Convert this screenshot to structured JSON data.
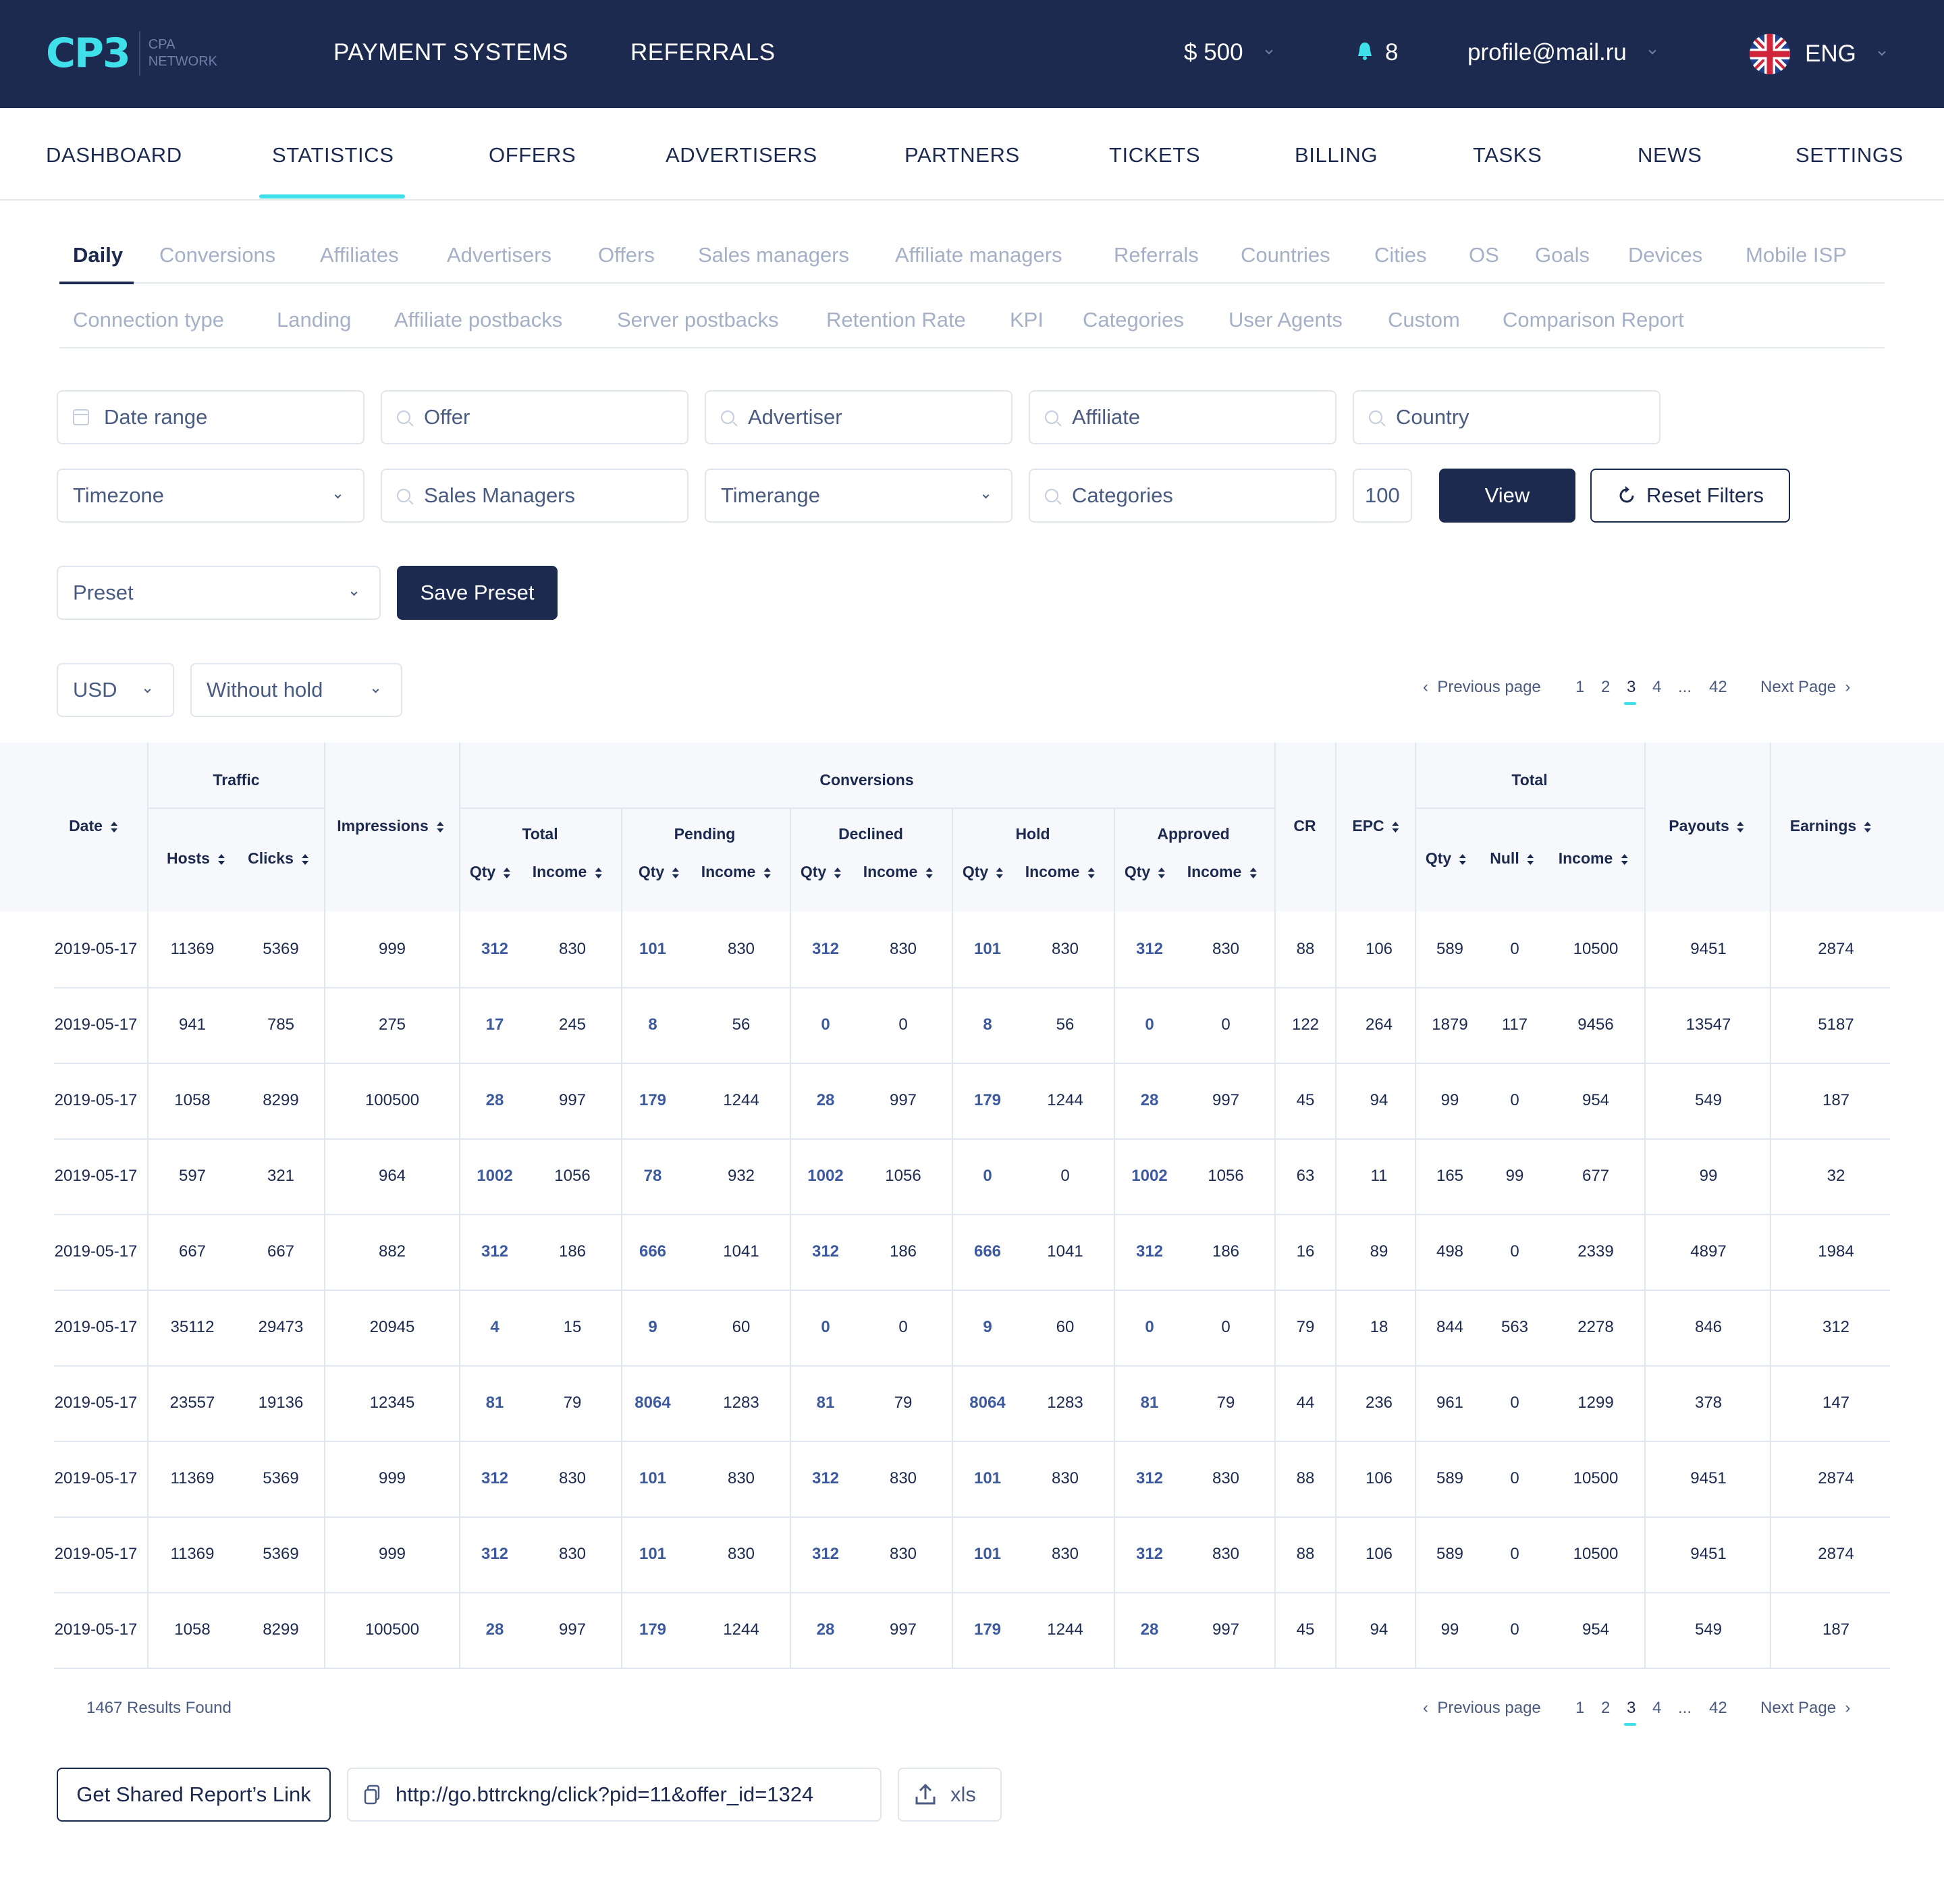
{
  "header": {
    "logo_main": "CP3",
    "logo_sub_1": "CPA",
    "logo_sub_2": "NETWORK",
    "nav": [
      "PAYMENT SYSTEMS",
      "REFERRALS"
    ],
    "balance": "$ 500",
    "notifications": "8",
    "profile": "profile@mail.ru",
    "language": "ENG"
  },
  "main_nav": [
    "DASHBOARD",
    "STATISTICS",
    "OFFERS",
    "ADVERTISERS",
    "PARTNERS",
    "TICKETS",
    "BILLING",
    "TASKS",
    "NEWS",
    "SETTINGS"
  ],
  "main_nav_active": "STATISTICS",
  "sub_tabs_row1": [
    "Daily",
    "Conversions",
    "Affiliates",
    "Advertisers",
    "Offers",
    "Sales managers",
    "Affiliate managers",
    "Referrals",
    "Countries",
    "Cities",
    "OS",
    "Goals",
    "Devices",
    "Mobile ISP"
  ],
  "sub_tabs_row2": [
    "Connection type",
    "Landing",
    "Affiliate postbacks",
    "Server postbacks",
    "Retention Rate",
    "KPI",
    "Categories",
    "User Agents",
    "Custom",
    "Comparison Report"
  ],
  "sub_tab_active": "Daily",
  "filters": {
    "date_range": "Date range",
    "offer": "Offer",
    "advertiser": "Advertiser",
    "affiliate": "Affiliate",
    "country": "Country",
    "timezone": "Timezone",
    "sales_managers": "Sales Managers",
    "timerange": "Timerange",
    "categories": "Categories",
    "limit": "100",
    "view_button": "View",
    "reset_button": "Reset Filters",
    "preset": "Preset",
    "save_preset": "Save Preset",
    "currency": "USD",
    "hold": "Without hold"
  },
  "pagination": {
    "prev": "Previous page",
    "pages": [
      "1",
      "2",
      "3",
      "4",
      "...",
      "42"
    ],
    "current": "3",
    "next": "Next Page"
  },
  "table": {
    "group_headers": {
      "traffic": "Traffic",
      "conversions": "Conversions",
      "total": "Total",
      "total_sub": "Total",
      "pending": "Pending",
      "declined": "Declined",
      "hold": "Hold",
      "approved": "Approved"
    },
    "headers": {
      "date": "Date",
      "hosts": "Hosts",
      "clicks": "Clicks",
      "impressions": "Impressions",
      "qty": "Qty",
      "income": "Income",
      "cr": "CR",
      "epc": "EPC",
      "null": "Null",
      "payouts": "Payouts",
      "earnings": "Earnings"
    },
    "rows": [
      [
        "2019-05-17",
        "11369",
        "5369",
        "999",
        "312",
        "830",
        "101",
        "830",
        "312",
        "830",
        "101",
        "830",
        "312",
        "830",
        "88",
        "106",
        "589",
        "0",
        "10500",
        "9451",
        "2874"
      ],
      [
        "2019-05-17",
        "941",
        "785",
        "275",
        "17",
        "245",
        "8",
        "56",
        "0",
        "0",
        "8",
        "56",
        "0",
        "0",
        "122",
        "264",
        "1879",
        "117",
        "9456",
        "13547",
        "5187"
      ],
      [
        "2019-05-17",
        "1058",
        "8299",
        "100500",
        "28",
        "997",
        "179",
        "1244",
        "28",
        "997",
        "179",
        "1244",
        "28",
        "997",
        "45",
        "94",
        "99",
        "0",
        "954",
        "549",
        "187"
      ],
      [
        "2019-05-17",
        "597",
        "321",
        "964",
        "1002",
        "1056",
        "78",
        "932",
        "1002",
        "1056",
        "0",
        "0",
        "1002",
        "1056",
        "63",
        "11",
        "165",
        "99",
        "677",
        "99",
        "32"
      ],
      [
        "2019-05-17",
        "667",
        "667",
        "882",
        "312",
        "186",
        "666",
        "1041",
        "312",
        "186",
        "666",
        "1041",
        "312",
        "186",
        "16",
        "89",
        "498",
        "0",
        "2339",
        "4897",
        "1984"
      ],
      [
        "2019-05-17",
        "35112",
        "29473",
        "20945",
        "4",
        "15",
        "9",
        "60",
        "0",
        "0",
        "9",
        "60",
        "0",
        "0",
        "79",
        "18",
        "844",
        "563",
        "2278",
        "846",
        "312"
      ],
      [
        "2019-05-17",
        "23557",
        "19136",
        "12345",
        "81",
        "79",
        "8064",
        "1283",
        "81",
        "79",
        "8064",
        "1283",
        "81",
        "79",
        "44",
        "236",
        "961",
        "0",
        "1299",
        "378",
        "147"
      ],
      [
        "2019-05-17",
        "11369",
        "5369",
        "999",
        "312",
        "830",
        "101",
        "830",
        "312",
        "830",
        "101",
        "830",
        "312",
        "830",
        "88",
        "106",
        "589",
        "0",
        "10500",
        "9451",
        "2874"
      ],
      [
        "2019-05-17",
        "11369",
        "5369",
        "999",
        "312",
        "830",
        "101",
        "830",
        "312",
        "830",
        "101",
        "830",
        "312",
        "830",
        "88",
        "106",
        "589",
        "0",
        "10500",
        "9451",
        "2874"
      ],
      [
        "2019-05-17",
        "1058",
        "8299",
        "100500",
        "28",
        "997",
        "179",
        "1244",
        "28",
        "997",
        "179",
        "1244",
        "28",
        "997",
        "45",
        "94",
        "99",
        "0",
        "954",
        "549",
        "187"
      ]
    ]
  },
  "results_found": "1467 Results Found",
  "footer": {
    "shared_link_button": "Get Shared Report’s Link",
    "shared_link_value": "http://go.bttrckng/click?pid=11&offer_id=1324",
    "export_label": "xls"
  },
  "colors": {
    "header_bg": "#1c2a50",
    "accent": "#3fe0ea",
    "link": "#3d5a9e",
    "muted": "#a5b0c7"
  }
}
